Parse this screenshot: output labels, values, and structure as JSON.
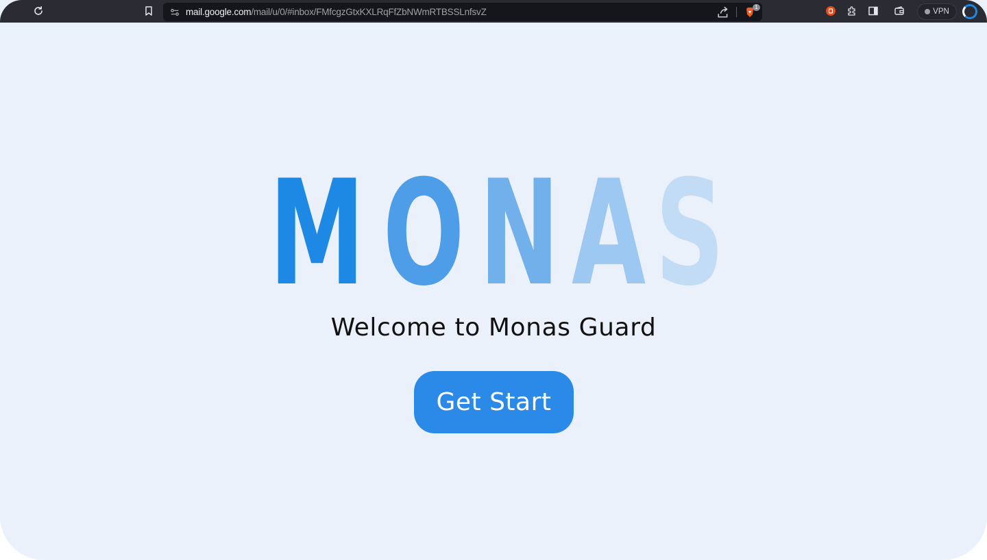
{
  "browser": {
    "url_host": "mail.google.com",
    "url_path": "/mail/u/0/#inbox/FMfcgzGtxKXLRqFfZbNWmRTBSSLnfsvZ",
    "shield_count": "1",
    "vpn_label": "VPN"
  },
  "hero": {
    "logo_letters": [
      "M",
      "O",
      "N",
      "A",
      "S"
    ],
    "logo_colors": [
      "#1e88e5",
      "#4d9de8",
      "#72b0ec",
      "#9dc8f1",
      "#c3dcf6"
    ],
    "welcome_text": "Welcome to Monas Guard",
    "cta_label": "Get Start"
  },
  "colors": {
    "background": "#eaf1fb",
    "accent": "#2b8ae8"
  }
}
